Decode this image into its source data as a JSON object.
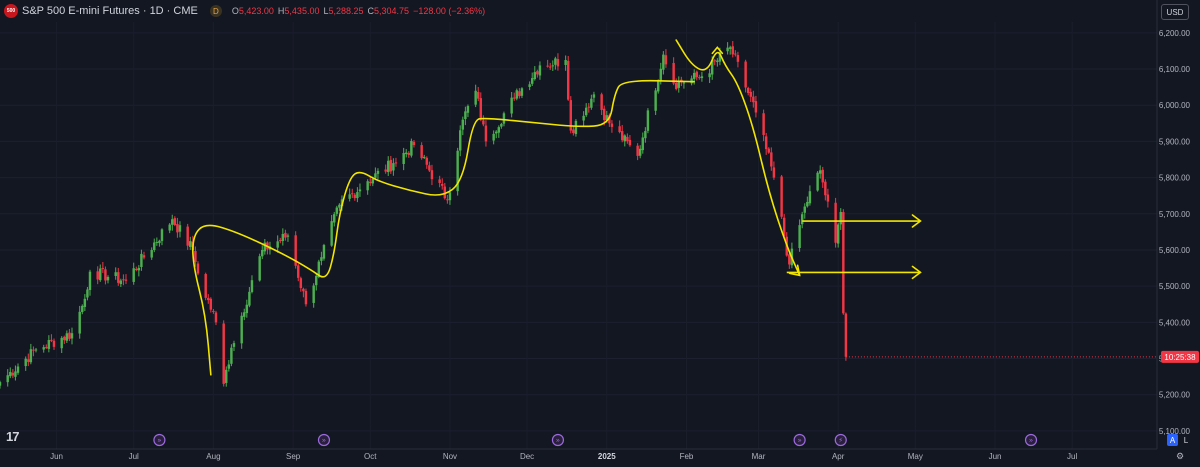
{
  "header": {
    "logo_text": "500",
    "title": "S&P 500 E-mini Futures · 1D · CME",
    "badge": "D",
    "ohlc": [
      {
        "key": "O",
        "value": "5,423.00"
      },
      {
        "key": "H",
        "value": "5,435.00"
      },
      {
        "key": "L",
        "value": "5,288.25"
      },
      {
        "key": "C",
        "value": "5,304.75"
      }
    ],
    "change": "−128.00 (−2.36%)"
  },
  "currency_button": "USD",
  "last_price_label": "10:25:38",
  "scale_buttons": {
    "auto": "A",
    "log": "L"
  },
  "tv_logo": "17",
  "colors": {
    "up": "#4caf50",
    "down": "#f23645",
    "drawing": "#f2e600",
    "background": "#131722",
    "event": "#9c6ade",
    "accent": "#2962ff"
  },
  "chart_data": {
    "type": "candlestick",
    "timeframe": "1D",
    "ylim": [
      5050,
      6230
    ],
    "y_ticks": [
      "6,200.00",
      "6,100.00",
      "6,000.00",
      "5,900.00",
      "5,800.00",
      "5,700.00",
      "5,600.00",
      "5,500.00",
      "5,400.00",
      "5,300.00",
      "5,200.00",
      "5,100.00"
    ],
    "y_tick_values": [
      6200,
      6100,
      6000,
      5900,
      5800,
      5700,
      5600,
      5500,
      5400,
      5300,
      5200,
      5100
    ],
    "x_ticks": [
      {
        "label": "Jun",
        "date": "2024-06-01"
      },
      {
        "label": "Jul",
        "date": "2024-07-01"
      },
      {
        "label": "Aug",
        "date": "2024-08-01"
      },
      {
        "label": "Sep",
        "date": "2024-09-01"
      },
      {
        "label": "Oct",
        "date": "2024-10-01"
      },
      {
        "label": "Nov",
        "date": "2024-11-01"
      },
      {
        "label": "Dec",
        "date": "2024-12-01"
      },
      {
        "label": "2025",
        "date": "2025-01-01"
      },
      {
        "label": "Feb",
        "date": "2025-02-01"
      },
      {
        "label": "Mar",
        "date": "2025-03-01"
      },
      {
        "label": "Apr",
        "date": "2025-04-01"
      },
      {
        "label": "May",
        "date": "2025-05-01"
      },
      {
        "label": "Jun",
        "date": "2025-06-01"
      },
      {
        "label": "Jul",
        "date": "2025-07-01"
      }
    ],
    "x_range": [
      "2024-05-10",
      "2025-08-03"
    ],
    "last_price": 5304.75,
    "events": [
      {
        "date": "2024-07-11",
        "icon": "forward-icon"
      },
      {
        "date": "2024-09-13",
        "icon": "forward-icon"
      },
      {
        "date": "2024-12-13",
        "icon": "forward-icon"
      },
      {
        "date": "2025-03-17",
        "icon": "forward-icon"
      },
      {
        "date": "2025-04-02",
        "icon": "lightning-icon"
      },
      {
        "date": "2025-06-15",
        "icon": "forward-icon"
      }
    ],
    "anchors": [
      {
        "date": "2024-05-10",
        "price": 5235
      },
      {
        "date": "2024-05-24",
        "price": 5325
      },
      {
        "date": "2024-06-07",
        "price": 5370
      },
      {
        "date": "2024-06-12",
        "price": 5465
      },
      {
        "date": "2024-06-14",
        "price": 5540
      },
      {
        "date": "2024-06-28",
        "price": 5515
      },
      {
        "date": "2024-07-16",
        "price": 5685
      },
      {
        "date": "2024-07-24",
        "price": 5600
      },
      {
        "date": "2024-07-26",
        "price": 5535
      },
      {
        "date": "2024-08-02",
        "price": 5400
      },
      {
        "date": "2024-08-05",
        "price": 5230
      },
      {
        "date": "2024-08-08",
        "price": 5330
      },
      {
        "date": "2024-08-20",
        "price": 5600
      },
      {
        "date": "2024-08-30",
        "price": 5640
      },
      {
        "date": "2024-09-06",
        "price": 5450
      },
      {
        "date": "2024-09-12",
        "price": 5580
      },
      {
        "date": "2024-09-19",
        "price": 5725
      },
      {
        "date": "2024-09-30",
        "price": 5790
      },
      {
        "date": "2024-10-10",
        "price": 5840
      },
      {
        "date": "2024-10-18",
        "price": 5890
      },
      {
        "date": "2024-10-31",
        "price": 5740
      },
      {
        "date": "2024-11-06",
        "price": 5960
      },
      {
        "date": "2024-11-11",
        "price": 6040
      },
      {
        "date": "2024-11-15",
        "price": 5900
      },
      {
        "date": "2024-11-26",
        "price": 6020
      },
      {
        "date": "2024-12-06",
        "price": 6110
      },
      {
        "date": "2024-12-16",
        "price": 6125
      },
      {
        "date": "2024-12-18",
        "price": 5930
      },
      {
        "date": "2024-12-27",
        "price": 6030
      },
      {
        "date": "2025-01-02",
        "price": 5950
      },
      {
        "date": "2025-01-13",
        "price": 5860
      },
      {
        "date": "2025-01-23",
        "price": 6140
      },
      {
        "date": "2025-01-27",
        "price": 6060
      },
      {
        "date": "2025-02-07",
        "price": 6080
      },
      {
        "date": "2025-02-18",
        "price": 6160
      },
      {
        "date": "2025-02-28",
        "price": 5980
      },
      {
        "date": "2025-03-07",
        "price": 5800
      },
      {
        "date": "2025-03-13",
        "price": 5560
      },
      {
        "date": "2025-03-19",
        "price": 5720
      },
      {
        "date": "2025-03-25",
        "price": 5820
      },
      {
        "date": "2025-03-31",
        "price": 5620
      },
      {
        "date": "2025-04-02",
        "price": 5705
      },
      {
        "date": "2025-04-03",
        "price": 5425
      },
      {
        "date": "2025-04-04",
        "price": 5305
      }
    ],
    "annotations": [
      {
        "type": "freehand",
        "points": [
          [
            "2024-07-31",
            5255
          ],
          [
            "2024-07-29",
            5420
          ],
          [
            "2024-07-24",
            5560
          ],
          [
            "2024-07-24",
            5640
          ],
          [
            "2024-07-29",
            5675
          ],
          [
            "2024-08-10",
            5650
          ],
          [
            "2024-08-28",
            5590
          ],
          [
            "2024-09-08",
            5545
          ],
          [
            "2024-09-14",
            5515
          ],
          [
            "2024-09-17",
            5590
          ],
          [
            "2024-09-19",
            5700
          ],
          [
            "2024-09-23",
            5800
          ],
          [
            "2024-09-27",
            5820
          ],
          [
            "2024-10-04",
            5790
          ],
          [
            "2024-10-16",
            5765
          ],
          [
            "2024-10-29",
            5745
          ],
          [
            "2024-11-06",
            5790
          ],
          [
            "2024-11-10",
            5960
          ],
          [
            "2024-11-15",
            5965
          ],
          [
            "2024-12-06",
            5950
          ],
          [
            "2024-12-21",
            5940
          ],
          [
            "2025-01-02",
            5945
          ],
          [
            "2025-01-04",
            6030
          ],
          [
            "2025-01-07",
            6070
          ],
          [
            "2025-02-04",
            6065
          ]
        ]
      },
      {
        "type": "freehand",
        "points": [
          [
            "2025-01-28",
            6180
          ],
          [
            "2025-02-03",
            6110
          ],
          [
            "2025-02-09",
            6090
          ],
          [
            "2025-02-13",
            6160
          ],
          [
            "2025-02-16",
            6110
          ],
          [
            "2025-02-21",
            6060
          ],
          [
            "2025-02-27",
            5940
          ],
          [
            "2025-03-05",
            5760
          ],
          [
            "2025-03-12",
            5610
          ],
          [
            "2025-03-17",
            5530
          ]
        ]
      },
      {
        "type": "arrow",
        "from": [
          "2025-03-12",
          5538
        ],
        "to": [
          "2025-05-03",
          5538
        ]
      },
      {
        "type": "arrow",
        "from": [
          "2025-03-18",
          5680
        ],
        "to": [
          "2025-05-03",
          5680
        ]
      }
    ]
  }
}
